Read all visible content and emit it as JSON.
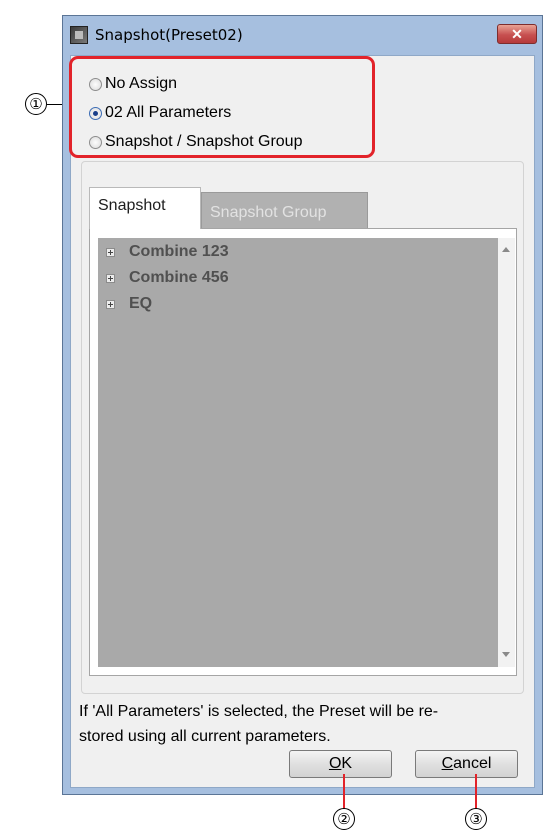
{
  "window": {
    "title": "Snapshot(Preset02)",
    "close_label": "✕"
  },
  "options": {
    "items": [
      {
        "label": "No Assign",
        "checked": false
      },
      {
        "label": "02 All Parameters",
        "checked": true
      },
      {
        "label": "Snapshot / Snapshot Group",
        "checked": false
      }
    ]
  },
  "tabs": [
    {
      "label": "Snapshot",
      "active": true
    },
    {
      "label": "Snapshot Group",
      "active": false
    }
  ],
  "tree": {
    "items": [
      {
        "label": "Combine 123"
      },
      {
        "label": "Combine 456"
      },
      {
        "label": "EQ"
      }
    ]
  },
  "info": {
    "line1": "If 'All Parameters' is selected, the Preset will be re-",
    "line2": "stored using all current parameters."
  },
  "buttons": {
    "ok_mnemonic": "O",
    "ok_rest": "K",
    "cancel_mnemonic": "C",
    "cancel_rest": "ancel"
  },
  "callouts": {
    "one": "①",
    "two": "②",
    "three": "③"
  },
  "colors": {
    "highlight": "#e2232a",
    "titlebar": "#a6bfdf",
    "close_button": "#c75050"
  }
}
